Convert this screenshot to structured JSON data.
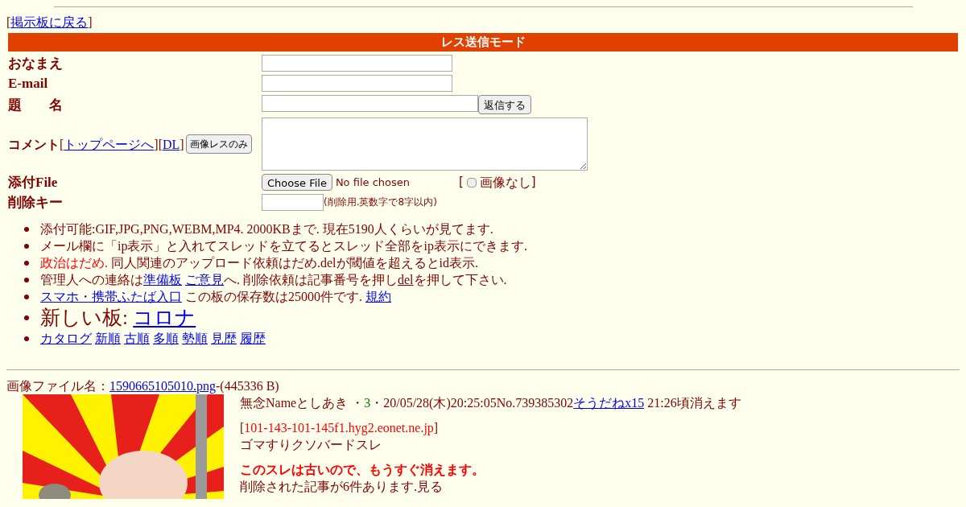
{
  "back": [
    {
      "kind": "text",
      "text": "["
    },
    {
      "kind": "link",
      "text": "掲示板に戻る"
    },
    {
      "kind": "text",
      "text": "]"
    }
  ],
  "form": {
    "title": "レス送信モード",
    "name_label": "おなまえ",
    "email_label": "E-mail",
    "subject_label": "題　　名",
    "submit": "返信する",
    "comment_label": [
      {
        "kind": "bold",
        "text": "コメント"
      },
      {
        "kind": "text",
        "text": "["
      },
      {
        "kind": "link",
        "text": "トップページへ"
      },
      {
        "kind": "text",
        "text": "]["
      },
      {
        "kind": "link",
        "text": "DL"
      },
      {
        "kind": "text",
        "text": "]"
      }
    ],
    "image_only_button": "画像レスのみ",
    "file_label": "添付File",
    "choose_file": "Choose File",
    "no_file": "No file chosen",
    "no_image_open": "[",
    "no_image_label": "画像なし",
    "no_image_close": "]",
    "no_image_checked": false,
    "key_label": "削除キー",
    "key_hint": "(削除用.英数字で8字以内)"
  },
  "notices": [
    {
      "kind": "normal",
      "segments": [
        {
          "kind": "text",
          "text": "添付可能:GIF,JPG,PNG,WEBM,MP4. 2000KBまで. 現在5190人くらいが見てます."
        }
      ]
    },
    {
      "kind": "normal",
      "segments": [
        {
          "kind": "text",
          "text": "メール欄に「ip表示」と入れてスレッドを立てるとスレッド全部をip表示にできます."
        }
      ]
    },
    {
      "kind": "normal",
      "segments": [
        {
          "kind": "alert",
          "text": "政治はだめ."
        },
        {
          "kind": "text",
          "gap": true,
          "text": "同人関連のアップロード依頼はだめ.delが閾値を超えるとid表示."
        }
      ]
    },
    {
      "kind": "normal",
      "segments": [
        {
          "kind": "text",
          "text": "管理人への連絡は"
        },
        {
          "kind": "link",
          "text": "準備板"
        },
        {
          "kind": "link",
          "gap": true,
          "text": "ご意見"
        },
        {
          "kind": "text",
          "text": "へ. 削除依頼は記事番号を押し"
        },
        {
          "kind": "del",
          "text": "del"
        },
        {
          "kind": "text",
          "text": "を押して下さい."
        }
      ]
    },
    {
      "kind": "normal",
      "segments": [
        {
          "kind": "link",
          "text": "スマホ・携帯ふたば入口"
        },
        {
          "kind": "text",
          "gap": true,
          "text": "この板の保存数は25000件です."
        },
        {
          "kind": "link",
          "gap": true,
          "text": "規約"
        }
      ]
    },
    {
      "kind": "large",
      "segments": [
        {
          "kind": "text",
          "text": "新しい板:"
        },
        {
          "kind": "link",
          "gap": true,
          "text": "コロナ"
        }
      ]
    },
    {
      "kind": "normal",
      "segments": [
        {
          "kind": "link",
          "text": "カタログ"
        },
        {
          "kind": "link",
          "gap": true,
          "text": "新順"
        },
        {
          "kind": "link",
          "gap": true,
          "text": "古順"
        },
        {
          "kind": "link",
          "gap": true,
          "text": "多順"
        },
        {
          "kind": "link",
          "gap": true,
          "text": "勢順"
        },
        {
          "kind": "link",
          "gap": true,
          "text": "見歴"
        },
        {
          "kind": "link",
          "gap": true,
          "text": "履歴"
        }
      ]
    }
  ],
  "post": {
    "file_line": [
      {
        "kind": "text",
        "text": "画像ファイル名："
      },
      {
        "kind": "link",
        "text": "1590665105010.png"
      },
      {
        "kind": "text",
        "text": "-(445336 B)"
      }
    ],
    "header": [
      {
        "kind": "text",
        "text": "無念"
      },
      {
        "kind": "text",
        "text": "Name"
      },
      {
        "kind": "text",
        "text": "としあき"
      },
      {
        "kind": "text",
        "gap": true,
        "text": "・"
      },
      {
        "kind": "green",
        "text": "3"
      },
      {
        "kind": "text",
        "text": "・20/05/28(木)20:25:05"
      },
      {
        "kind": "text",
        "text": "No.739385302"
      },
      {
        "kind": "link",
        "text": "そうだねx15"
      },
      {
        "kind": "text",
        "gap": true,
        "text": "21:26頃消えます"
      }
    ],
    "host": [
      {
        "kind": "text",
        "text": "["
      },
      {
        "kind": "alert",
        "text": "101-143-101-145f1.hyg2.eonet.ne.jp"
      },
      {
        "kind": "text",
        "text": "]"
      }
    ],
    "body": "ゴマすりクソバードスレ",
    "warning": "このスレは古いので、もうすぐ消えます。",
    "deleted": "削除された記事が6件あります.見る"
  }
}
